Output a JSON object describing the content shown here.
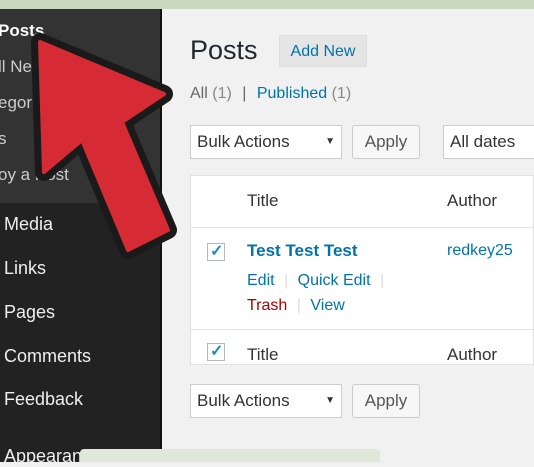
{
  "sidebar": {
    "posts_label": "Posts",
    "sub_items": [
      "ll New",
      "egories",
      "s",
      "oy a Post"
    ],
    "items": [
      "Media",
      "Links",
      "Pages",
      "Comments",
      "Feedback",
      "Appearance"
    ]
  },
  "header": {
    "title": "Posts",
    "add_new": "Add New"
  },
  "filters": {
    "all": "All",
    "all_count": "(1)",
    "sep": "|",
    "published": "Published",
    "published_count": "(1)"
  },
  "tablenav_top": {
    "bulk_actions": "Bulk Actions",
    "apply": "Apply",
    "dates": "All dates"
  },
  "table": {
    "col_title": "Title",
    "col_author": "Author",
    "rows": [
      {
        "title": "Test Test Test",
        "author": "redkey25",
        "actions": {
          "edit": "Edit",
          "quick_edit": "Quick Edit",
          "trash": "Trash",
          "view": "View"
        }
      }
    ],
    "footer_title": "Title",
    "footer_author": "Author"
  },
  "tablenav_bottom": {
    "bulk_actions": "Bulk Actions",
    "apply": "Apply"
  },
  "colors": {
    "sidebar": "#222222",
    "link": "#0073aa",
    "trash": "#aa0000",
    "arrow": "#d62b35"
  }
}
